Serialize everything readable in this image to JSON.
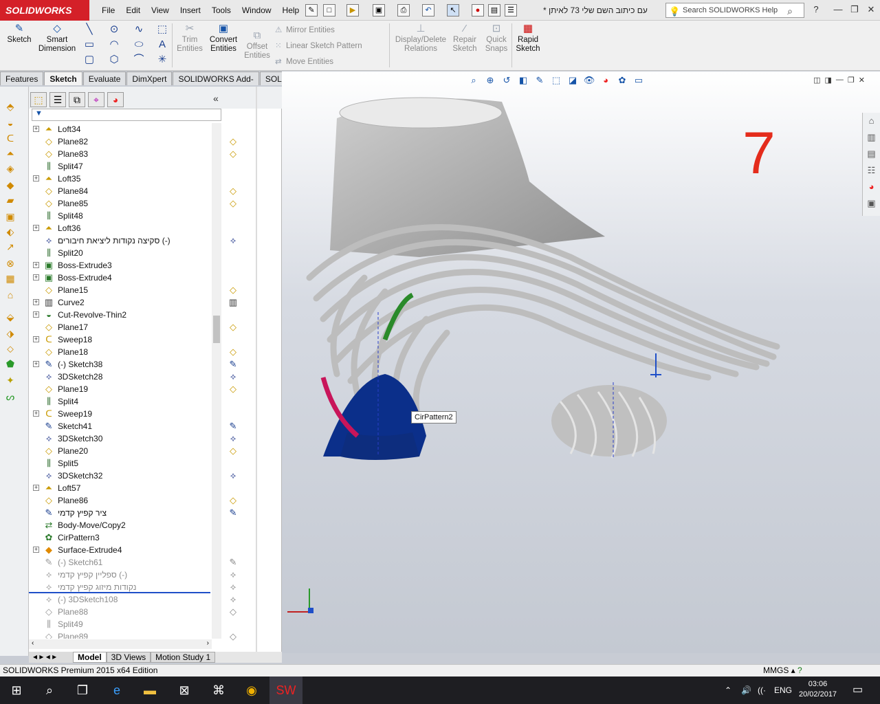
{
  "app": {
    "brand": "SOLIDWORKS",
    "menus": [
      "File",
      "Edit",
      "View",
      "Insert",
      "Tools",
      "Window",
      "Help"
    ],
    "doc_title": "* עם כיתוב השם שלי 73 לאיתן",
    "search_placeholder": "Search SOLIDWORKS Help"
  },
  "ribbon": {
    "sketch": "Sketch",
    "smart_dimension": "Smart Dimension",
    "trim_entities": "Trim Entities",
    "convert_entities": "Convert Entities",
    "offset_entities": "Offset Entities",
    "mirror_entities": "Mirror Entities",
    "linear_sketch_pattern": "Linear Sketch Pattern",
    "move_entities": "Move Entities",
    "display_delete_relations": "Display/Delete Relations",
    "repair_sketch": "Repair Sketch",
    "quick_snaps": "Quick Snaps",
    "rapid_sketch": "Rapid Sketch"
  },
  "tabs": [
    "Features",
    "Sketch",
    "Evaluate",
    "DimXpert",
    "SOLIDWORKS Add-Ins",
    "SOLIDWORKS MBD"
  ],
  "active_tab": "Sketch",
  "tree": [
    {
      "label": "Loft34",
      "icon": "loft-icon",
      "exp": true
    },
    {
      "label": "Plane82",
      "icon": "plane-icon",
      "exp": false
    },
    {
      "label": "Plane83",
      "icon": "plane-icon",
      "exp": false
    },
    {
      "label": "Split47",
      "icon": "split-icon",
      "exp": false
    },
    {
      "label": "Loft35",
      "icon": "loft-icon",
      "exp": true
    },
    {
      "label": "Plane84",
      "icon": "plane-icon",
      "exp": false
    },
    {
      "label": "Plane85",
      "icon": "plane-icon",
      "exp": false
    },
    {
      "label": "Split48",
      "icon": "split-icon",
      "exp": false
    },
    {
      "label": "Loft36",
      "icon": "loft-icon",
      "exp": true
    },
    {
      "label": "סקיצה נקודות ליציאת חיבורים (-)",
      "icon": "3dsketch-icon",
      "exp": false
    },
    {
      "label": "Split20",
      "icon": "split-icon",
      "exp": false
    },
    {
      "label": "Boss-Extrude3",
      "icon": "extrude-icon",
      "exp": true
    },
    {
      "label": "Boss-Extrude4",
      "icon": "extrude-icon",
      "exp": true
    },
    {
      "label": "Plane15",
      "icon": "plane-icon",
      "exp": false
    },
    {
      "label": "Curve2",
      "icon": "curve-icon",
      "exp": true
    },
    {
      "label": "Cut-Revolve-Thin2",
      "icon": "revolve-icon",
      "exp": true
    },
    {
      "label": "Plane17",
      "icon": "plane-icon",
      "exp": false
    },
    {
      "label": "Sweep18",
      "icon": "sweep-icon",
      "exp": true
    },
    {
      "label": "Plane18",
      "icon": "plane-icon",
      "exp": false
    },
    {
      "label": "(-) Sketch38",
      "icon": "sketch-icon",
      "exp": true
    },
    {
      "label": "3DSketch28",
      "icon": "3dsketch-icon",
      "exp": false
    },
    {
      "label": "Plane19",
      "icon": "plane-icon",
      "exp": false
    },
    {
      "label": "Split4",
      "icon": "split-icon",
      "exp": false
    },
    {
      "label": "Sweep19",
      "icon": "sweep-icon",
      "exp": true
    },
    {
      "label": "Sketch41",
      "icon": "sketch-icon",
      "exp": false
    },
    {
      "label": "3DSketch30",
      "icon": "3dsketch-icon",
      "exp": false
    },
    {
      "label": "Plane20",
      "icon": "plane-icon",
      "exp": false
    },
    {
      "label": "Split5",
      "icon": "split-icon",
      "exp": false
    },
    {
      "label": "3DSketch32",
      "icon": "3dsketch-icon",
      "exp": false
    },
    {
      "label": "Loft57",
      "icon": "loft-icon",
      "exp": true
    },
    {
      "label": "Plane86",
      "icon": "plane-icon",
      "exp": false
    },
    {
      "label": "ציר קפיץ קדמי",
      "icon": "sketch-icon",
      "exp": false
    },
    {
      "label": "Body-Move/Copy2",
      "icon": "move-icon",
      "exp": false
    },
    {
      "label": "CirPattern3",
      "icon": "cirpattern-icon",
      "exp": false
    },
    {
      "label": "Surface-Extrude4",
      "icon": "surface-icon",
      "exp": true
    },
    {
      "label": "(-) Sketch61",
      "icon": "sketch-icon",
      "exp": false,
      "sup": true
    },
    {
      "label": "ספליין קפיץ קדמי (-)",
      "icon": "3dsketch-icon",
      "exp": false,
      "sup": true
    },
    {
      "label": "נקודות מיזוג קפיץ קדמי",
      "icon": "3dsketch-icon",
      "exp": false,
      "sup": true
    },
    {
      "label": "(-) 3DSketch108",
      "icon": "3dsketch-icon",
      "exp": false,
      "sup": true
    },
    {
      "label": "Plane88",
      "icon": "plane-icon",
      "exp": false,
      "sup": true
    },
    {
      "label": "Split49",
      "icon": "split-icon",
      "exp": false,
      "sup": true
    },
    {
      "label": "Plane89",
      "icon": "plane-icon",
      "exp": false,
      "sup": true
    }
  ],
  "viewport": {
    "big_number": "7",
    "tooltip": "CirPattern2"
  },
  "bottom_tabs": [
    "Model",
    "3D Views",
    "Motion Study 1"
  ],
  "status": {
    "edition": "SOLIDWORKS Premium 2015 x64 Edition",
    "units": "MMGS"
  },
  "taskbar": {
    "lang": "ENG",
    "time": "03:06",
    "date": "20/02/2017"
  }
}
